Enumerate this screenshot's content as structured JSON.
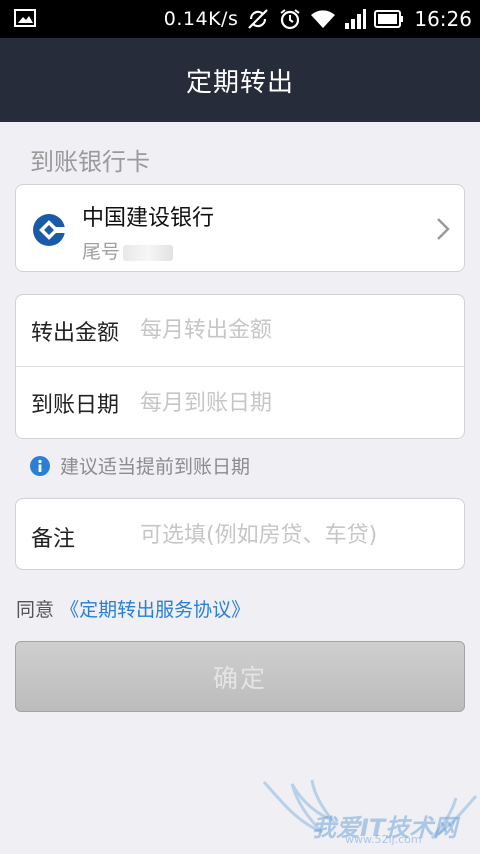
{
  "status_bar": {
    "net_speed": "0.14K/s",
    "time": "16:26",
    "icons": [
      "image-icon",
      "no-sync-icon",
      "alarm-icon",
      "wifi-icon",
      "signal-icon",
      "battery-icon"
    ]
  },
  "header": {
    "title": "定期转出"
  },
  "bank_section": {
    "label": "到账银行卡",
    "bank_name": "中国建设银行",
    "tail_label": "尾号",
    "logo_color": "#1a5ba8"
  },
  "form": {
    "amount_label": "转出金额",
    "amount_placeholder": "每月转出金额",
    "date_label": "到账日期",
    "date_placeholder": "每月到账日期"
  },
  "hint": {
    "text": "建议适当提前到账日期",
    "icon_color": "#2a7fd4"
  },
  "note": {
    "label": "备注",
    "placeholder": "可选填(例如房贷、车贷)"
  },
  "agreement": {
    "prefix": "同意",
    "link": "《定期转出服务协议》",
    "link_color": "#2a7fd4"
  },
  "confirm": {
    "label": "确定"
  },
  "watermark": {
    "text": "我爱IT技术网",
    "sub": "www.52ij.com"
  }
}
